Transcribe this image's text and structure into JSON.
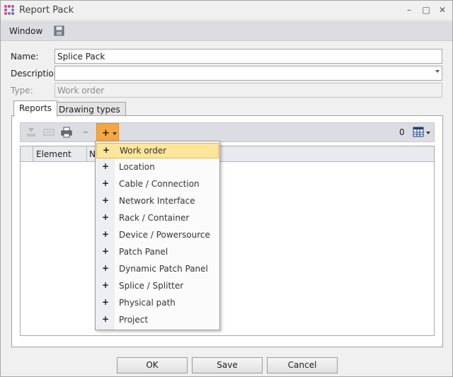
{
  "window": {
    "title": "Report Pack"
  },
  "menubar": {
    "window_label": "Window"
  },
  "form": {
    "name_label": "Name:",
    "name_value": "Splice Pack",
    "description_label": "Description:",
    "description_value": "",
    "type_label": "Type:",
    "type_value": "Work order"
  },
  "tabs": [
    {
      "label": "Reports",
      "active": true
    },
    {
      "label": "Drawing types",
      "active": false
    }
  ],
  "toolbar": {
    "count": "0"
  },
  "grid": {
    "columns": [
      "Element",
      "N"
    ]
  },
  "add_menu": {
    "items": [
      "Work order",
      "Location",
      "Cable / Connection",
      "Network Interface",
      "Rack / Container",
      "Device / Powersource",
      "Patch Panel",
      "Dynamic Patch Panel",
      "Splice / Splitter",
      "Physical path",
      "Project"
    ],
    "highlighted": "Work order",
    "item_glyph": "+"
  },
  "buttons": {
    "ok": "OK",
    "save": "Save",
    "cancel": "Cancel"
  },
  "titlebar": {
    "minimize": "–",
    "maximize": "□",
    "close": "✕"
  },
  "colors": {
    "accent": "#f5a742",
    "highlight": "#fde59a",
    "menubar": "#dcdde3"
  }
}
